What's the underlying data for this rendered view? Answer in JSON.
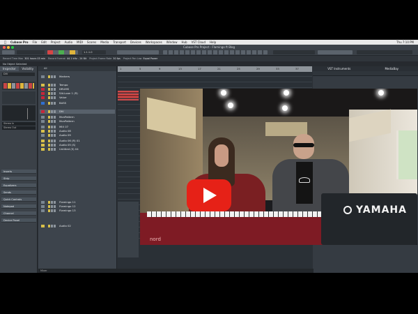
{
  "macos": {
    "menu": [
      "Cubase Pro",
      "File",
      "Edit",
      "Project",
      "Audio",
      "MIDI",
      "Scores",
      "Media",
      "Transport",
      "Devices",
      "Workspaces",
      "Window",
      "Hub",
      "VST Cloud",
      "Help"
    ],
    "clock": "Thu 7:10 PM"
  },
  "window": {
    "title": "Cubase Pro Project - Flamingo ft Blog",
    "traffic_colors": [
      "#ff5f57",
      "#ffbd2e",
      "#28c940"
    ]
  },
  "toolbar": {
    "transport_counter": "1.1.1.0"
  },
  "infoline": {
    "record_time_max_label": "Record Time Max",
    "record_time_max_value": "301 hours 03 min",
    "record_format_label": "Record Format",
    "record_format_value": "44.1 kHz - 24 Bit",
    "frame_rate_label": "Project Frame Rate",
    "frame_rate_value": "30 fps",
    "pan_law_label": "Project Pan Law",
    "pan_law_value": "Equal Power"
  },
  "status": {
    "text": "No Object Selected"
  },
  "inspector": {
    "tabs": [
      "Inspector",
      "Visibility"
    ],
    "track_name": "DIV",
    "input": "Stereo In",
    "output": "Stereo Out",
    "sections": [
      "Inserts",
      "Strip",
      "Equalizers",
      "Sends",
      "Quick Controls",
      "Notepad",
      "Channel",
      "Device Panel"
    ]
  },
  "tracklist": {
    "header": "All",
    "tracks": [
      {
        "name": "Markers",
        "color": "#7a8691"
      },
      {
        "name": "Tempo",
        "color": "#d8c04a"
      },
      {
        "name": "DRUMS",
        "color": "#c7263a"
      },
      {
        "name": "SALLoon 1 (R)",
        "color": "#c7263a"
      },
      {
        "name": "Value",
        "color": "#c7263a"
      },
      {
        "name": "BASS",
        "color": "#2f6fd1"
      },
      {
        "name": "DIV",
        "color": "#c7263a"
      },
      {
        "name": "MonPattern",
        "color": "#7a8691"
      },
      {
        "name": "MonPattern",
        "color": "#7a8691"
      },
      {
        "name": "MIX 07",
        "color": "#7a8691"
      },
      {
        "name": "Audio 08",
        "color": "#d8c04a"
      },
      {
        "name": "Audio 09",
        "color": "#7a8691"
      },
      {
        "name": "Audio 06 (R) 01",
        "color": "#d8c04a"
      },
      {
        "name": "Audio 05 (S)",
        "color": "#d8c04a"
      },
      {
        "name": "Untitled (S) 04",
        "color": "#d8c04a"
      },
      {
        "name": "Flamingo 11",
        "color": "#7a8691"
      },
      {
        "name": "Flamingo 12",
        "color": "#7a8691"
      },
      {
        "name": "Flamingo 13",
        "color": "#7a8691"
      },
      {
        "name": "Audio 02",
        "color": "#d8c04a"
      }
    ]
  },
  "arrange": {
    "ruler_marks": [
      "1",
      "5",
      "9",
      "13",
      "17",
      "21",
      "25",
      "29",
      "33",
      "37"
    ]
  },
  "vsti": {
    "tabs": [
      "VST Instruments",
      "MediaBay"
    ]
  },
  "video": {
    "play_button": "YouTube play button",
    "keyboard_left_brand": "nord",
    "keyboard_right_brand": "YAMAHA"
  },
  "bottom": {
    "label": "Mixer"
  }
}
